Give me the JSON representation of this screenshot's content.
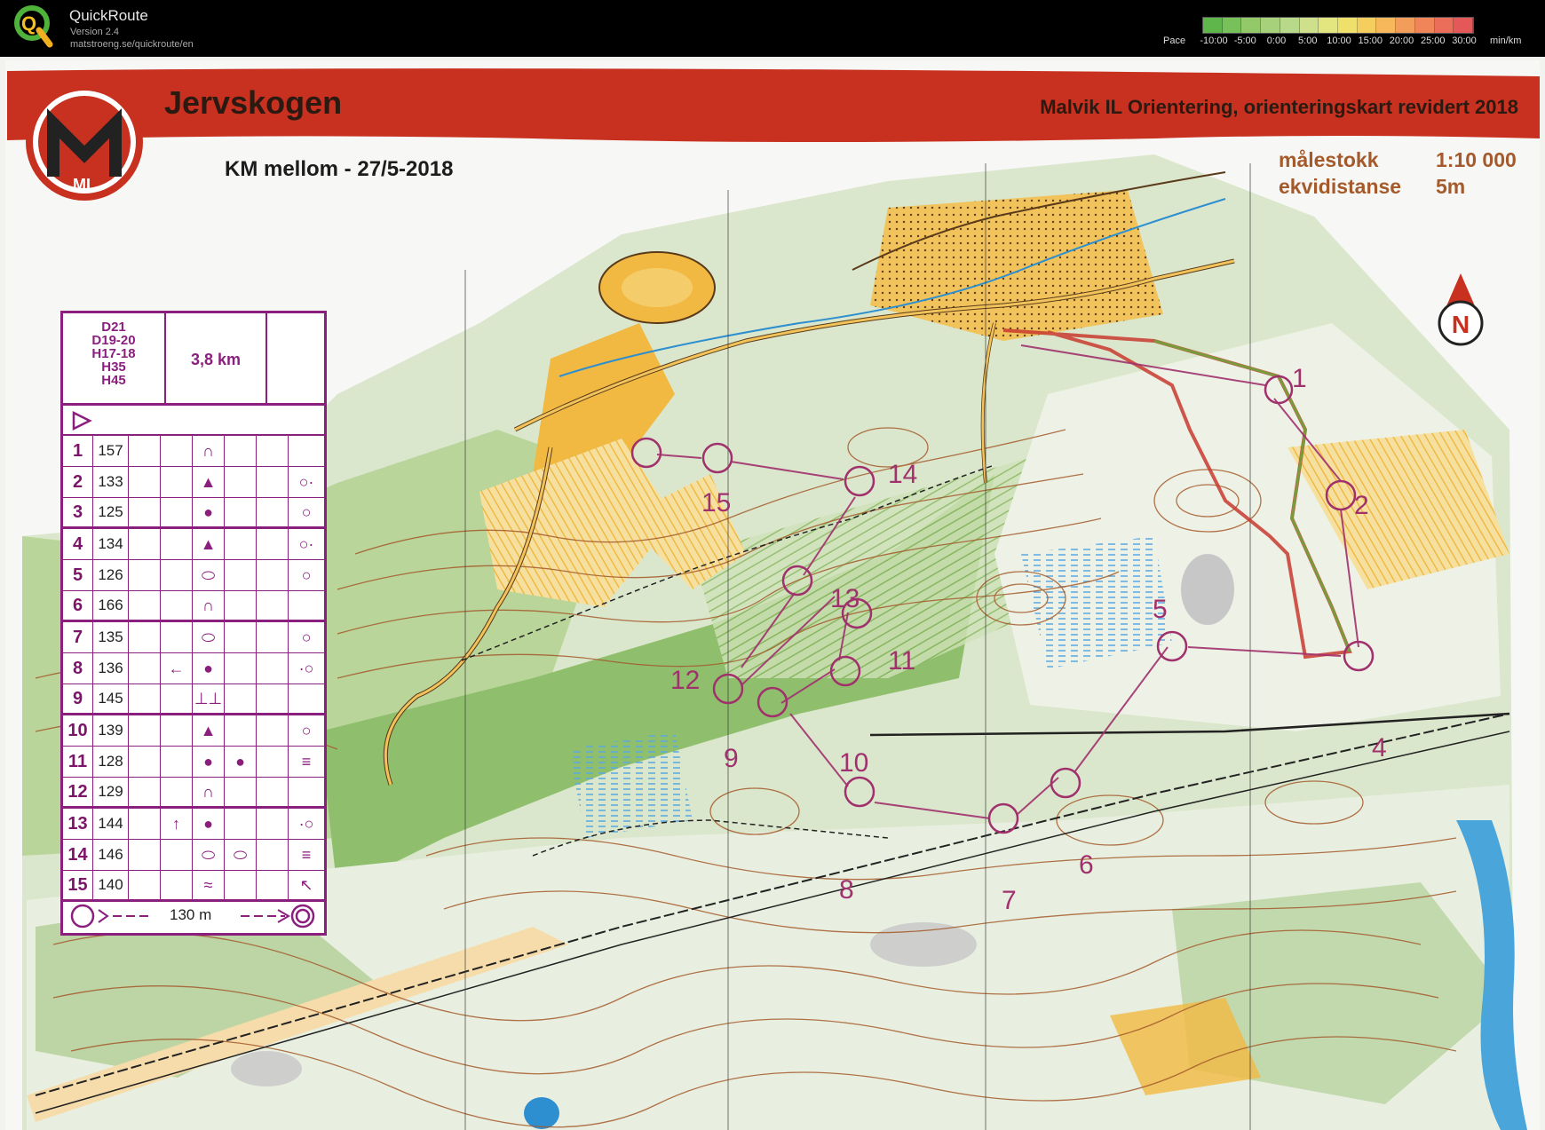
{
  "app": {
    "name": "QuickRoute",
    "version": "Version 2.4",
    "url": "matstroeng.se/quickroute/en"
  },
  "pace_scale": {
    "label": "Pace",
    "ticks": [
      "-10:00",
      "-5:00",
      "0:00",
      "5:00",
      "10:00",
      "15:00",
      "20:00",
      "25:00",
      "30:00"
    ],
    "unit": "min/km",
    "colors": [
      "#5fb64a",
      "#78c05a",
      "#93c968",
      "#a7d17a",
      "#b9d98a",
      "#cfe08c",
      "#e3e67e",
      "#efe06c",
      "#f5cf5e",
      "#f6b85a",
      "#f39d5a",
      "#ef8559",
      "#ea6e5a",
      "#e4585a"
    ]
  },
  "map": {
    "title": "Jervskogen",
    "event": "KM mellom - 27/5-2018",
    "publisher": "Malvik IL Orientering, orienteringskart revidert 2018",
    "scale_label": "målestokk",
    "scale_value": "1:10 000",
    "contour_label": "ekvidistanse",
    "contour_value": "5m",
    "north_label": "N",
    "club_logo_letters": "ML",
    "controls": [
      "1",
      "2",
      "4",
      "5",
      "6",
      "7",
      "8",
      "9",
      "10",
      "11",
      "12",
      "13",
      "14",
      "15"
    ],
    "colors": {
      "header_red": "#c8301f",
      "course_purple": "#a0316d",
      "forest_green": "#a9c98b",
      "open_yellow": "#f1b941",
      "contour_brown": "#a45a2b",
      "route_green": "#6aa83a",
      "route_red": "#c83a2f"
    }
  },
  "description_sheet": {
    "classes": [
      "D21",
      "D19-20",
      "H17-18",
      "H35",
      "H45"
    ],
    "length": "3,8 km",
    "rows": [
      {
        "n": "1",
        "code": "157",
        "col4": "",
        "col5": "∩",
        "col6": "",
        "col8": ""
      },
      {
        "n": "2",
        "code": "133",
        "col4": "",
        "col5": "▲",
        "col6": "",
        "col8": "○·"
      },
      {
        "n": "3",
        "code": "125",
        "col4": "",
        "col5": "●",
        "col6": "",
        "col8": "○"
      },
      {
        "n": "4",
        "code": "134",
        "col4": "",
        "col5": "▲",
        "col6": "",
        "col8": "○·"
      },
      {
        "n": "5",
        "code": "126",
        "col4": "",
        "col5": "⬭",
        "col6": "",
        "col8": "○"
      },
      {
        "n": "6",
        "code": "166",
        "col4": "",
        "col5": "∩",
        "col6": "",
        "col8": ""
      },
      {
        "n": "7",
        "code": "135",
        "col4": "",
        "col5": "⬭",
        "col6": "",
        "col8": "○"
      },
      {
        "n": "8",
        "code": "136",
        "col4": "←",
        "col5": "●",
        "col6": "",
        "col8": "·○"
      },
      {
        "n": "9",
        "code": "145",
        "col4": "",
        "col5": "⊥⊥",
        "col6": "",
        "col8": ""
      },
      {
        "n": "10",
        "code": "139",
        "col4": "",
        "col5": "▲",
        "col6": "",
        "col8": "○"
      },
      {
        "n": "11",
        "code": "128",
        "col4": "",
        "col5": "●",
        "col6": "●",
        "col8": "≡"
      },
      {
        "n": "12",
        "code": "129",
        "col4": "",
        "col5": "∩",
        "col6": "",
        "col8": ""
      },
      {
        "n": "13",
        "code": "144",
        "col4": "↑",
        "col5": "●",
        "col6": "",
        "col8": "·○"
      },
      {
        "n": "14",
        "code": "146",
        "col4": "",
        "col5": "⬭",
        "col6": "⬭",
        "col8": "≡"
      },
      {
        "n": "15",
        "code": "140",
        "col4": "",
        "col5": "≈",
        "col6": "",
        "col8": "↖"
      }
    ],
    "finish_distance": "130 m"
  }
}
